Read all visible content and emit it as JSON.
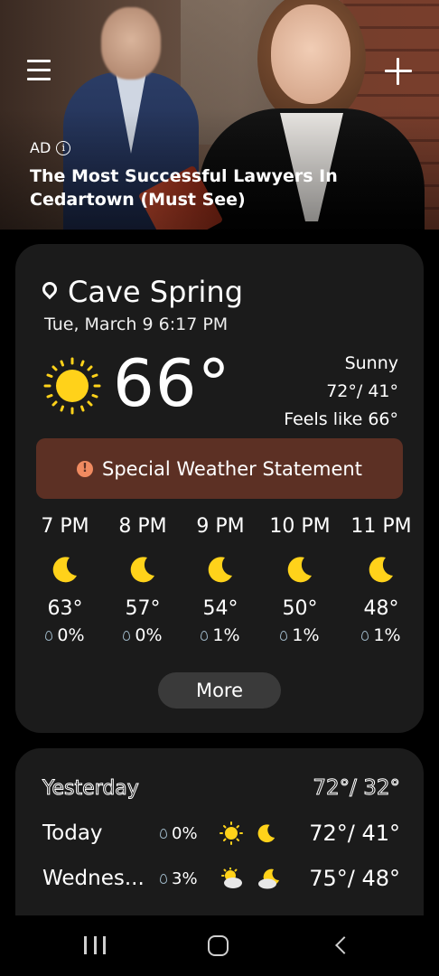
{
  "ad": {
    "badge": "AD",
    "info": "i",
    "title": "The Most Successful Lawyers In Cedartown (Must See)"
  },
  "current": {
    "location": "Cave Spring",
    "datetime": "Tue, March 9 6:17 PM",
    "temperature": "66°",
    "condition": "Sunny",
    "high_low": "72°/ 41°",
    "feels_like": "Feels like 66°",
    "icon": "sun-icon"
  },
  "alert": {
    "label": "Special Weather Statement",
    "icon": "alert-icon",
    "color": "#5c3024"
  },
  "hourly": [
    {
      "time": "7 PM",
      "temp": "63°",
      "precip": "0%",
      "icon": "moon-icon"
    },
    {
      "time": "8 PM",
      "temp": "57°",
      "precip": "0%",
      "icon": "moon-icon"
    },
    {
      "time": "9 PM",
      "temp": "54°",
      "precip": "1%",
      "icon": "moon-icon"
    },
    {
      "time": "10 PM",
      "temp": "50°",
      "precip": "1%",
      "icon": "moon-icon"
    },
    {
      "time": "11 PM",
      "temp": "48°",
      "precip": "1%",
      "icon": "moon-icon"
    }
  ],
  "more_label": "More",
  "daily": [
    {
      "day": "Yesterday",
      "precip": "",
      "high_low": "72°/ 32°"
    },
    {
      "day": "Today",
      "precip": "0%",
      "high_low": "72°/ 41°",
      "day_icon": "sun-icon",
      "night_icon": "moon-icon"
    },
    {
      "day": "Wednes...",
      "precip": "3%",
      "high_low": "75°/ 48°",
      "day_icon": "partly-cloudy-icon",
      "night_icon": "partly-cloudy-night-icon"
    }
  ],
  "colors": {
    "card": "#1b1b1b",
    "sun": "#ffd21a",
    "moon": "#ffd21a"
  }
}
